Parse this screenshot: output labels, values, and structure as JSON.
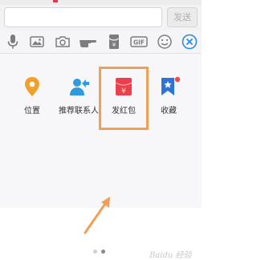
{
  "input_bar": {
    "text_value": "",
    "send_label": "发送"
  },
  "toolbar": {
    "icons": [
      "microphone-icon",
      "image-icon",
      "camera-icon",
      "poke-icon",
      "red-packet-icon",
      "gif-icon",
      "emoji-icon",
      "close-icon"
    ],
    "gif_text": "GIF"
  },
  "apps": [
    {
      "label": "位置",
      "icon": "location-pin-icon",
      "color": "#f0a12d"
    },
    {
      "label": "推荐联系人",
      "icon": "recommend-contact-icon",
      "color": "#2f9ae0"
    },
    {
      "label": "发红包",
      "icon": "red-packet-icon",
      "color": "#e9404f",
      "symbol": "¥"
    },
    {
      "label": "收藏",
      "icon": "favorite-bookmark-icon",
      "color": "#2d74d9",
      "badge_color": "#f04848"
    }
  ],
  "highlight": {
    "target": "发红包",
    "color": "#f0a054"
  },
  "pagination": {
    "total": 2,
    "current": 2
  },
  "watermark": "Baidu 经验"
}
